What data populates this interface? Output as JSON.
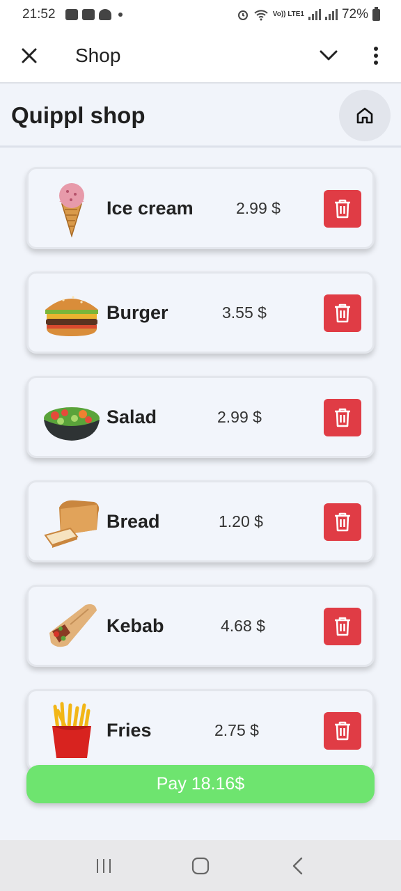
{
  "status_bar": {
    "time": "21:52",
    "battery": "72%",
    "network": "Vo)) LTE1"
  },
  "app_bar": {
    "title": "Shop"
  },
  "header": {
    "title": "Quippl shop"
  },
  "cart": {
    "items": [
      {
        "name": "Ice cream",
        "price": "2.99 $",
        "image": "ice-cream-image"
      },
      {
        "name": "Burger",
        "price": "3.55 $",
        "image": "burger-image"
      },
      {
        "name": "Salad",
        "price": "2.99 $",
        "image": "salad-image"
      },
      {
        "name": "Bread",
        "price": "1.20 $",
        "image": "bread-image"
      },
      {
        "name": "Kebab",
        "price": "4.68 $",
        "image": "kebab-image"
      },
      {
        "name": "Fries",
        "price": "2.75 $",
        "image": "fries-image"
      }
    ]
  },
  "pay": {
    "label": "Pay 18.16$"
  },
  "colors": {
    "delete": "#e03c45",
    "pay": "#6ee46f",
    "background": "#f1f4fa"
  }
}
